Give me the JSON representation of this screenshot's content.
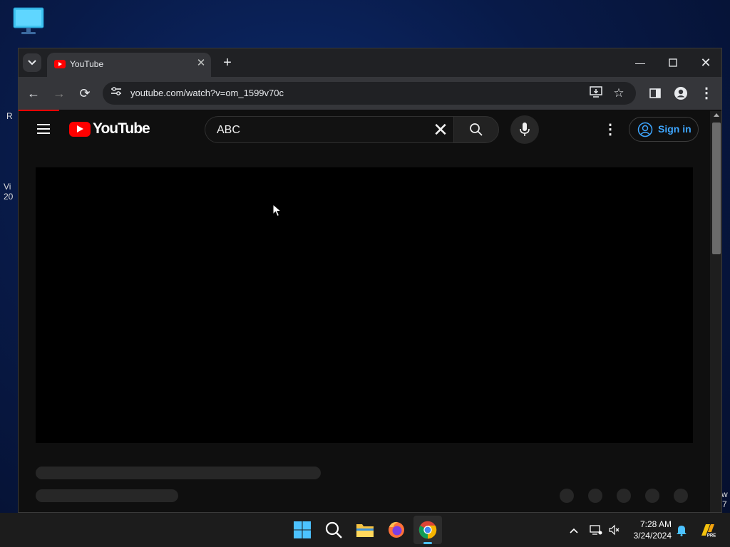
{
  "browser": {
    "tab_title": "YouTube",
    "url": "youtube.com/watch?v=om_1599v70c"
  },
  "youtube": {
    "logo_text": "YouTube",
    "search_value": "ABC",
    "sign_in_label": "Sign in"
  },
  "desktop": {
    "clipped_text_1": "R",
    "clipped_text_2": "Vi",
    "clipped_text_3": "20",
    "clipped_text_4": "w",
    "clipped_text_5": "7"
  },
  "taskbar": {
    "time": "7:28 AM",
    "date": "3/24/2024"
  },
  "colors": {
    "youtube_red": "#ff0000",
    "link_blue": "#3ea6ff",
    "page_bg": "#0f0f0f"
  }
}
